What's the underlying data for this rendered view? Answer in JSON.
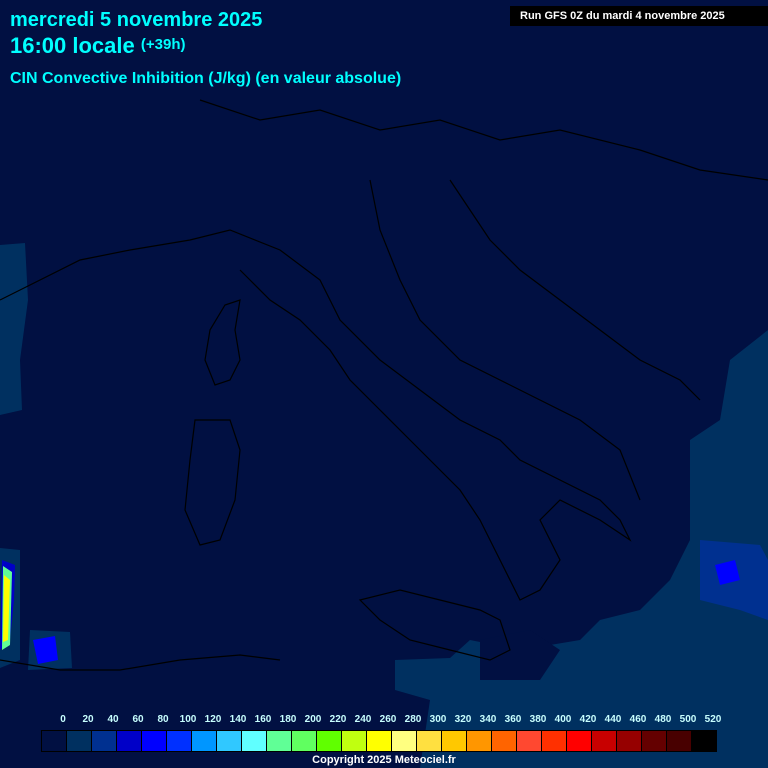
{
  "header": {
    "date": "mercredi 5 novembre 2025",
    "time": "16:00 locale",
    "lead": "(+39h)",
    "parameter": "CIN Convective Inhibition (J/kg) (en valeur absolue)",
    "run": "Run GFS 0Z du mardi 4 novembre 2025"
  },
  "legend": {
    "labels": [
      "0",
      "20",
      "40",
      "60",
      "80",
      "100",
      "120",
      "140",
      "160",
      "180",
      "200",
      "220",
      "240",
      "260",
      "280",
      "300",
      "320",
      "340",
      "360",
      "380",
      "400",
      "420",
      "440",
      "460",
      "480",
      "500",
      "520"
    ],
    "colors": [
      "#011042",
      "#003060",
      "#003090",
      "#0000c8",
      "#0000ff",
      "#0030ff",
      "#0096ff",
      "#30c8ff",
      "#60ffff",
      "#60ff96",
      "#60ff60",
      "#60ff00",
      "#c0ff10",
      "#ffff00",
      "#ffff80",
      "#ffe040",
      "#ffc800",
      "#ff9600",
      "#ff6400",
      "#ff4830",
      "#ff3000",
      "#ff0000",
      "#c80000",
      "#960000",
      "#640000",
      "#480000",
      "#000000"
    ]
  },
  "footer": {
    "copyright": "Copyright 2025 Meteociel.fr"
  }
}
